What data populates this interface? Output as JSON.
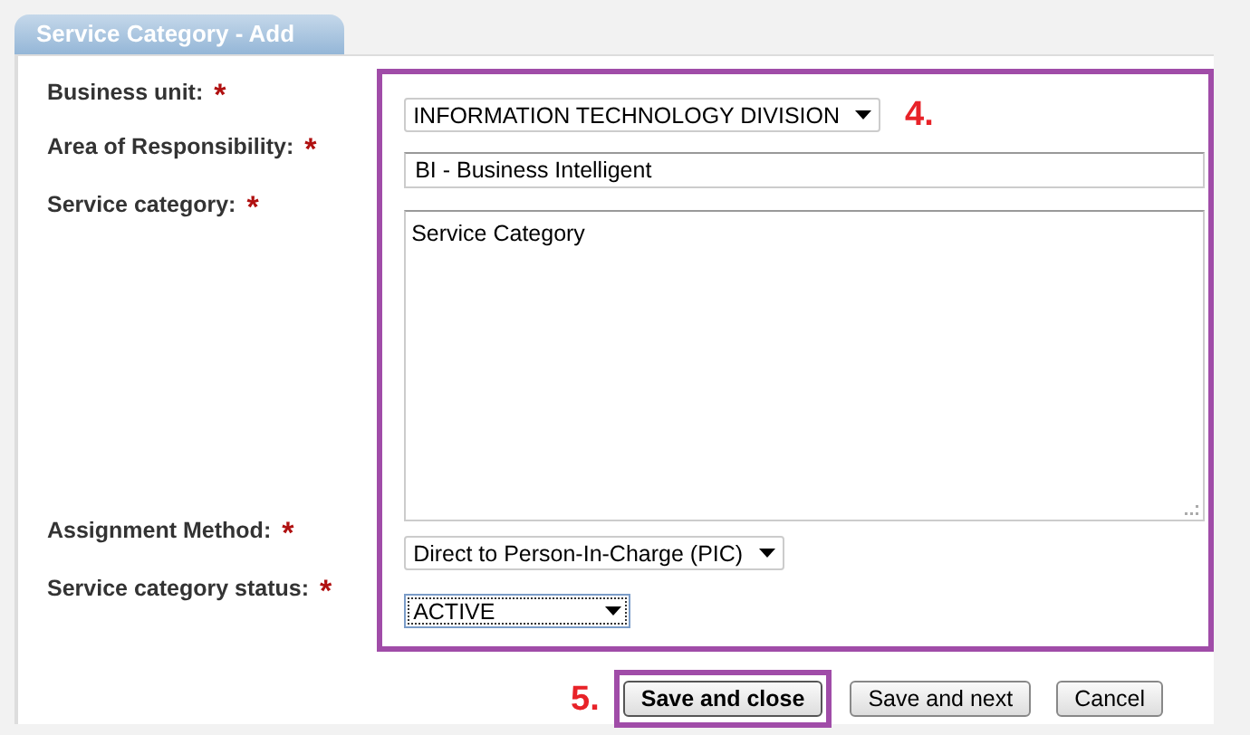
{
  "tab": {
    "title": "Service Category - Add",
    "selected": true
  },
  "fields": [
    {
      "kind": "select",
      "label": "Business unit:",
      "required_mark": "*",
      "value": "INFORMATION TECHNOLOGY DIVISION",
      "focused": false
    },
    {
      "kind": "input",
      "label": "Area of Responsibility:",
      "required_mark": "*",
      "value": "BI - Business Intelligent"
    },
    {
      "kind": "textarea",
      "label": "Service category:",
      "required_mark": "*",
      "value": "Service Category"
    },
    {
      "kind": "select",
      "label": "Assignment Method:",
      "required_mark": "*",
      "value": "Direct to Person-In-Charge (PIC)",
      "focused": false
    },
    {
      "kind": "select",
      "label": "Service category status:",
      "required_mark": "*",
      "value": "ACTIVE",
      "focused": true
    }
  ],
  "fields_callout": "4.",
  "buttons_callout": "5.",
  "buttons": [
    {
      "label": "Save and close",
      "default": true,
      "highlighted": true
    },
    {
      "label": "Save and next",
      "default": false,
      "highlighted": false
    },
    {
      "label": "Cancel",
      "default": false,
      "highlighted": false
    }
  ]
}
